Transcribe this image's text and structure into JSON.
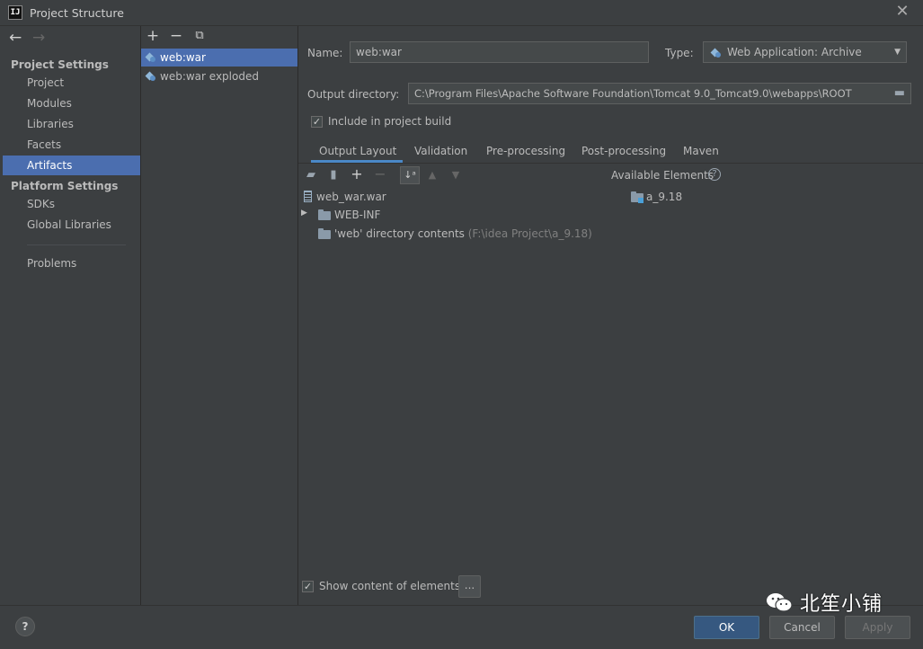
{
  "window": {
    "title": "Project Structure",
    "app_logo_text": "IJ"
  },
  "sidebar": {
    "sections": [
      {
        "heading": "Project Settings",
        "items": [
          "Project",
          "Modules",
          "Libraries",
          "Facets",
          "Artifacts"
        ]
      },
      {
        "heading": "Platform Settings",
        "items": [
          "SDKs",
          "Global Libraries"
        ]
      }
    ],
    "extra_items": [
      "Problems"
    ],
    "selected": "Artifacts"
  },
  "artifacts": {
    "toolbar": [
      "plus-icon",
      "minus-icon",
      "copy-icon"
    ],
    "items": [
      "web:war",
      "web:war exploded"
    ],
    "selected": "web:war"
  },
  "form": {
    "name_label": "Name:",
    "name_value": "web:war",
    "type_label": "Type:",
    "type_value": "Web Application: Archive",
    "output_label": "Output directory:",
    "output_value": "C:\\Program Files\\Apache Software Foundation\\Tomcat 9.0_Tomcat9.0\\webapps\\ROOT",
    "include_build_label": "Include in project build",
    "include_build_checked": true
  },
  "tabs": [
    "Output Layout",
    "Validation",
    "Pre-processing",
    "Post-processing",
    "Maven"
  ],
  "active_tab": "Output Layout",
  "layout_tree": {
    "root": "web_war.war",
    "children": [
      {
        "label": "WEB-INF",
        "suffix": ""
      },
      {
        "label": "'web' directory contents",
        "suffix": "(F:\\idea Project\\a_9.18)"
      }
    ]
  },
  "available": {
    "heading": "Available Elements",
    "items": [
      "a_9.18"
    ]
  },
  "show_content": {
    "label": "Show content of elements",
    "checked": true,
    "more_button": "..."
  },
  "footer": {
    "help": "?",
    "ok": "OK",
    "cancel": "Cancel",
    "apply": "Apply"
  },
  "watermark": "北笙小铺",
  "colors": {
    "selection": "#4b6eaf",
    "primary_button": "#365880",
    "tab_underline": "#4a88c7"
  }
}
